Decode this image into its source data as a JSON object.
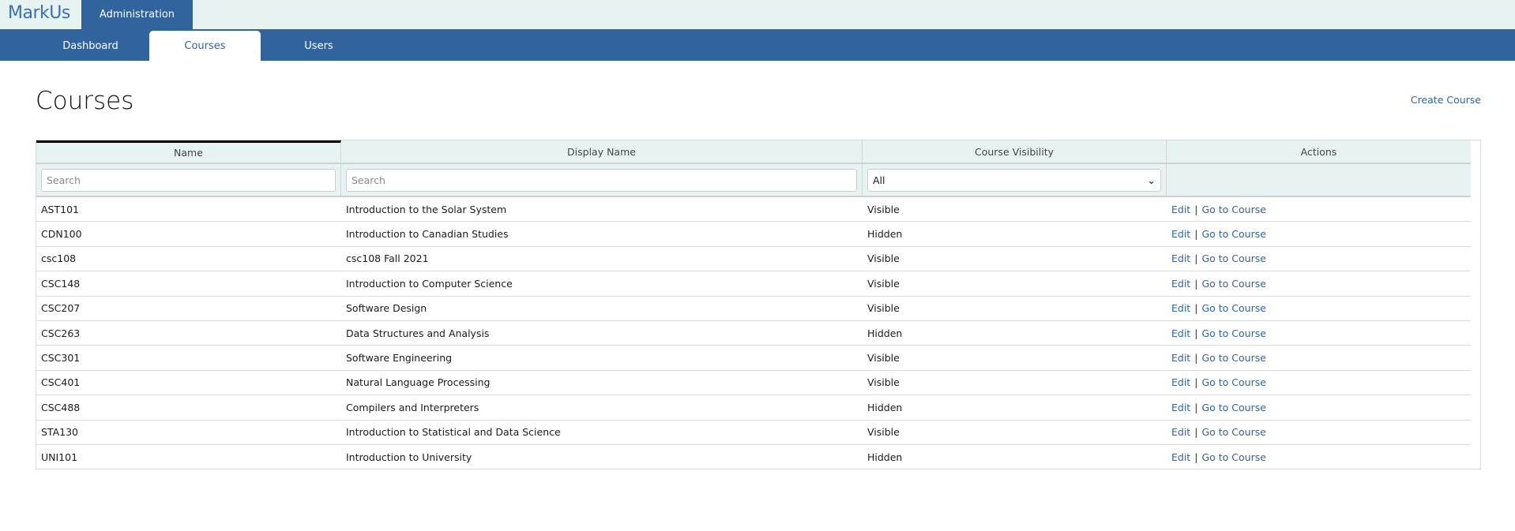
{
  "header": {
    "logo": "MarkUs",
    "section": "Administration"
  },
  "nav": {
    "tabs": [
      {
        "label": "Dashboard"
      },
      {
        "label": "Courses",
        "active": true
      },
      {
        "label": "Users"
      }
    ]
  },
  "page": {
    "title": "Courses",
    "create_label": "Create Course"
  },
  "table": {
    "columns": [
      "Name",
      "Display Name",
      "Course Visibility",
      "Actions"
    ],
    "filters": {
      "name_placeholder": "Search",
      "display_placeholder": "Search",
      "visibility_selected": "All"
    },
    "edit_label": "Edit",
    "separator": "|",
    "goto_label": "Go to Course",
    "rows": [
      {
        "name": "AST101",
        "display": "Introduction to the Solar System",
        "visibility": "Visible"
      },
      {
        "name": "CDN100",
        "display": "Introduction to Canadian Studies",
        "visibility": "Hidden"
      },
      {
        "name": "csc108",
        "display": "csc108 Fall 2021",
        "visibility": "Visible"
      },
      {
        "name": "CSC148",
        "display": "Introduction to Computer Science",
        "visibility": "Visible"
      },
      {
        "name": "CSC207",
        "display": "Software Design",
        "visibility": "Visible"
      },
      {
        "name": "CSC263",
        "display": "Data Structures and Analysis",
        "visibility": "Hidden"
      },
      {
        "name": "CSC301",
        "display": "Software Engineering",
        "visibility": "Visible"
      },
      {
        "name": "CSC401",
        "display": "Natural Language Processing",
        "visibility": "Visible"
      },
      {
        "name": "CSC488",
        "display": "Compilers and Interpreters",
        "visibility": "Hidden"
      },
      {
        "name": "STA130",
        "display": "Introduction to Statistical and Data Science",
        "visibility": "Visible"
      },
      {
        "name": "UNI101",
        "display": "Introduction to University",
        "visibility": "Hidden"
      }
    ]
  },
  "colors": {
    "brand": "#31639c",
    "header_bg": "#e6f3f0"
  }
}
